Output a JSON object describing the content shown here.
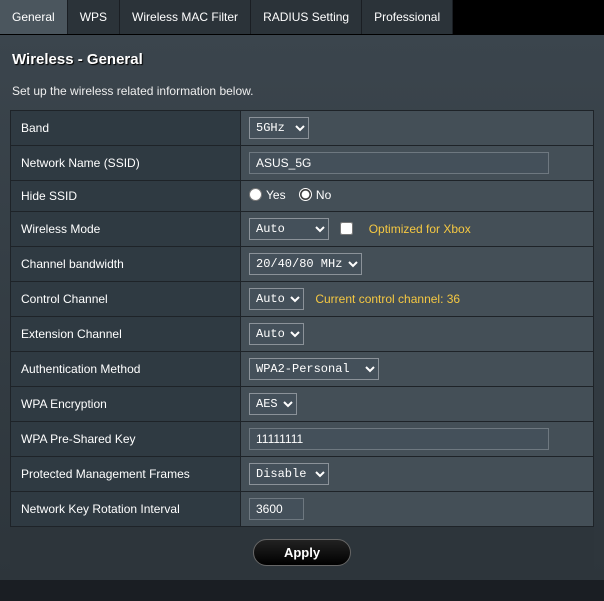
{
  "tabs": [
    "General",
    "WPS",
    "Wireless MAC Filter",
    "RADIUS Setting",
    "Professional"
  ],
  "active_tab": 0,
  "page_title": "Wireless - General",
  "subtitle": "Set up the wireless related information below.",
  "fields": {
    "band": {
      "label": "Band",
      "value": "5GHz"
    },
    "ssid": {
      "label": "Network Name (SSID)",
      "value": "ASUS_5G"
    },
    "hide_ssid": {
      "label": "Hide SSID",
      "yes": "Yes",
      "no": "No",
      "value": "No"
    },
    "wireless_mode": {
      "label": "Wireless Mode",
      "value": "Auto",
      "xbox_hint": "Optimized for Xbox"
    },
    "channel_bw": {
      "label": "Channel bandwidth",
      "value": "20/40/80 MHz"
    },
    "ctrl_channel": {
      "label": "Control Channel",
      "value": "Auto",
      "hint": "Current control channel: 36"
    },
    "ext_channel": {
      "label": "Extension Channel",
      "value": "Auto"
    },
    "auth_method": {
      "label": "Authentication Method",
      "value": "WPA2-Personal"
    },
    "wpa_enc": {
      "label": "WPA Encryption",
      "value": "AES"
    },
    "wpa_psk": {
      "label": "WPA Pre-Shared Key",
      "value": "11111111"
    },
    "pmf": {
      "label": "Protected Management Frames",
      "value": "Disable"
    },
    "key_rotation": {
      "label": "Network Key Rotation Interval",
      "value": "3600"
    }
  },
  "apply_label": "Apply"
}
